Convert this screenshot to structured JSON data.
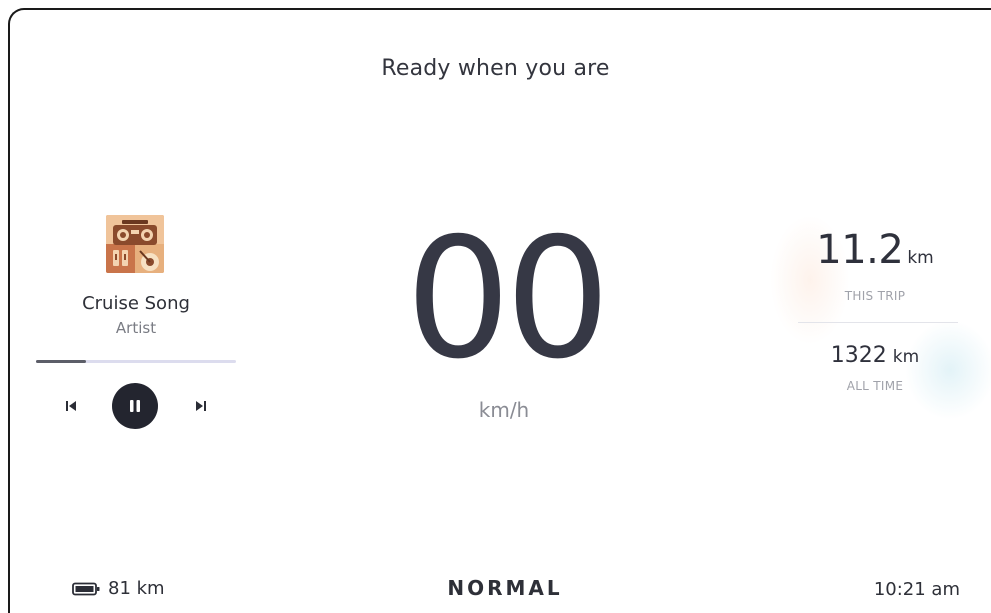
{
  "header": {
    "title": "Ready when you are"
  },
  "media": {
    "album_art": "boombox-album-art",
    "song_title": "Cruise Song",
    "artist": "Artist",
    "progress": 0.25,
    "controls": {
      "previous": "skip-previous-icon",
      "play_state": "pause-icon",
      "next": "skip-next-icon"
    }
  },
  "speedometer": {
    "speed": "00",
    "unit": "km/h"
  },
  "trip": {
    "this_trip_value": "11.2",
    "this_trip_unit": "km",
    "this_trip_label": "THIS TRIP",
    "all_time_value": "1322",
    "all_time_unit": "km",
    "all_time_label": "ALL TIME"
  },
  "status_bar": {
    "battery_icon": "battery-icon",
    "range": "81 km",
    "drive_mode": "NORMAL",
    "time": "10:21 am"
  },
  "colors": {
    "text_primary": "#2e3038",
    "text_secondary": "#8a8c94",
    "progress_track": "#dcdcee",
    "control_dark": "#23252f"
  }
}
